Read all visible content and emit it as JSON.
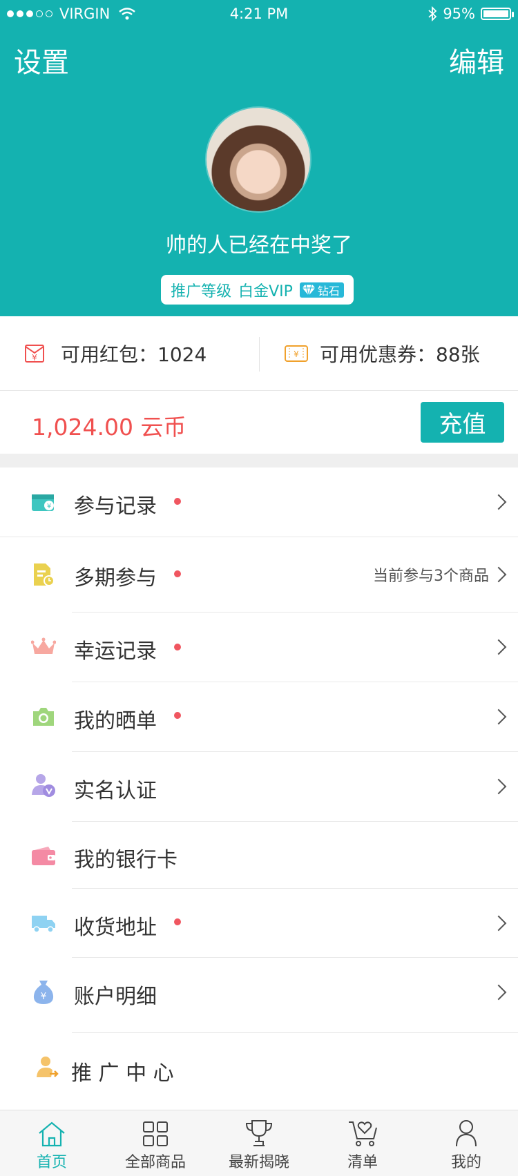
{
  "status_bar": {
    "carrier": "VIRGIN",
    "time": "4:21 PM",
    "battery": "95%"
  },
  "header": {
    "left_action": "设置",
    "right_action": "编辑",
    "username": "帅的人已经在中奖了",
    "level_label": "推广等级",
    "level_value": "白金VIP",
    "diamond_label": "钻石"
  },
  "wallet": {
    "red_packet_label": "可用红包：1024",
    "coupon_label": "可用优惠券：88张"
  },
  "balance": {
    "amount": "1,024.00 云币",
    "recharge_label": "充值"
  },
  "menu": [
    {
      "label": "参与记录",
      "icon": "wallet-icon",
      "dot": true,
      "sub": "",
      "chevron": true
    },
    {
      "label": "多期参与",
      "icon": "document-clock-icon",
      "dot": true,
      "sub": "当前参与3个商品",
      "chevron": true
    },
    {
      "label": "幸运记录",
      "icon": "crown-icon",
      "dot": true,
      "sub": "",
      "chevron": true
    },
    {
      "label": "我的晒单",
      "icon": "camera-icon",
      "dot": true,
      "sub": "",
      "chevron": true
    },
    {
      "label": "实名认证",
      "icon": "user-verify-icon",
      "dot": false,
      "sub": "",
      "chevron": true
    },
    {
      "label": "我的银行卡",
      "icon": "bank-card-icon",
      "dot": false,
      "sub": "",
      "chevron": false
    },
    {
      "label": "收货地址",
      "icon": "truck-icon",
      "dot": true,
      "sub": "",
      "chevron": true
    },
    {
      "label": "账户明细",
      "icon": "money-bag-icon",
      "dot": false,
      "sub": "",
      "chevron": true
    },
    {
      "label": "推 广 中 心",
      "icon": "promoter-icon",
      "dot": false,
      "sub": "",
      "chevron": false
    }
  ],
  "tabbar": {
    "tabs": [
      {
        "label": "首页",
        "icon": "home-icon",
        "active": true
      },
      {
        "label": "全部商品",
        "icon": "grid-icon",
        "active": false
      },
      {
        "label": "最新揭晓",
        "icon": "trophy-icon",
        "active": false
      },
      {
        "label": "清单",
        "icon": "cart-heart-icon",
        "active": false
      },
      {
        "label": "我的",
        "icon": "person-icon",
        "active": false
      }
    ]
  },
  "colors": {
    "primary": "#14b2b0",
    "accent_red": "#f0504f",
    "dot_red": "#f05660",
    "separator": "#e8e8e8"
  }
}
